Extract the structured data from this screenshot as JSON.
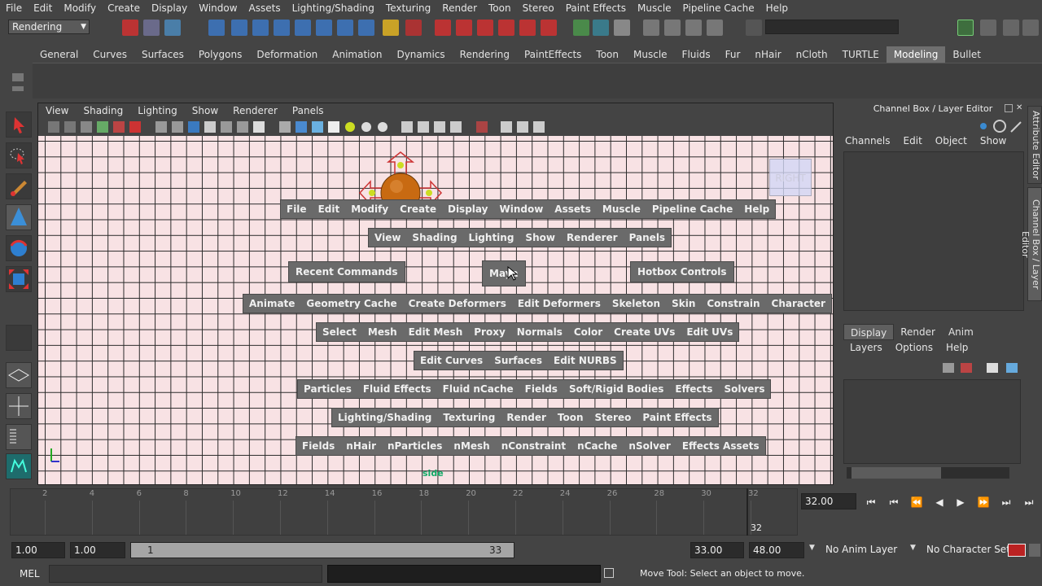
{
  "menubar": [
    "File",
    "Edit",
    "Modify",
    "Create",
    "Display",
    "Window",
    "Assets",
    "Lighting/Shading",
    "Texturing",
    "Render",
    "Toon",
    "Stereo",
    "Paint Effects",
    "Muscle",
    "Pipeline Cache",
    "Help"
  ],
  "statusline": {
    "mode": "Rendering"
  },
  "shelf_tabs": [
    "General",
    "Curves",
    "Surfaces",
    "Polygons",
    "Deformation",
    "Animation",
    "Dynamics",
    "Rendering",
    "PaintEffects",
    "Toon",
    "Muscle",
    "Fluids",
    "Fur",
    "nHair",
    "nCloth",
    "TURTLE",
    "Modeling",
    "Bullet"
  ],
  "shelf_active": "Modeling",
  "viewport": {
    "menu": [
      "View",
      "Shading",
      "Lighting",
      "Show",
      "Renderer",
      "Panels"
    ],
    "viewcube_label": "RIGHT",
    "camera_label": "side"
  },
  "hotbox": {
    "row1": [
      "File",
      "Edit",
      "Modify",
      "Create",
      "Display",
      "Window",
      "Assets",
      "Muscle",
      "Pipeline Cache",
      "Help"
    ],
    "row2": [
      "View",
      "Shading",
      "Lighting",
      "Show",
      "Renderer",
      "Panels"
    ],
    "recent": "Recent Commands",
    "center": "Maya",
    "controls": "Hotbox Controls",
    "row3": [
      "Animate",
      "Geometry Cache",
      "Create Deformers",
      "Edit Deformers",
      "Skeleton",
      "Skin",
      "Constrain",
      "Character"
    ],
    "row4": [
      "Select",
      "Mesh",
      "Edit Mesh",
      "Proxy",
      "Normals",
      "Color",
      "Create UVs",
      "Edit UVs"
    ],
    "row5": [
      "Edit Curves",
      "Surfaces",
      "Edit NURBS"
    ],
    "row6": [
      "Particles",
      "Fluid Effects",
      "Fluid nCache",
      "Fields",
      "Soft/Rigid Bodies",
      "Effects",
      "Solvers"
    ],
    "row7": [
      "Lighting/Shading",
      "Texturing",
      "Render",
      "Toon",
      "Stereo",
      "Paint Effects"
    ],
    "row8": [
      "Fields",
      "nHair",
      "nParticles",
      "nMesh",
      "nConstraint",
      "nCache",
      "nSolver",
      "Effects Assets"
    ]
  },
  "channelbox": {
    "title": "Channel Box / Layer Editor",
    "menu": [
      "Channels",
      "Edit",
      "Object",
      "Show"
    ],
    "layer_tabs": [
      "Display",
      "Render",
      "Anim"
    ],
    "layer_active": "Display",
    "layer_menu": [
      "Layers",
      "Options",
      "Help"
    ],
    "side_tabs": [
      "Attribute Editor",
      "Channel Box / Layer Editor"
    ]
  },
  "timeslider": {
    "ticks": [
      "2",
      "4",
      "6",
      "8",
      "10",
      "12",
      "14",
      "16",
      "18",
      "20",
      "22",
      "24",
      "26",
      "28",
      "30",
      "32"
    ],
    "end_marker": "32",
    "current_frame": "32.00"
  },
  "range": {
    "start_time": "1.00",
    "playback_start": "1.00",
    "range_start": "1",
    "range_end": "33",
    "playback_end": "33.00",
    "end_time": "48.00",
    "anim_layer": "No Anim Layer",
    "character_set": "No Character Set"
  },
  "cmdline": {
    "label": "MEL",
    "help": "Move Tool: Select an object to move."
  }
}
